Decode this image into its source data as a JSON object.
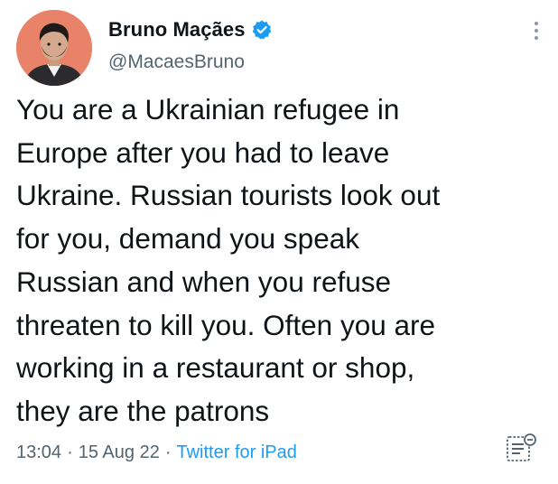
{
  "author": {
    "display_name": "Bruno Maçães",
    "handle": "@MacaesBruno",
    "verified": true
  },
  "tweet": {
    "lines": [
      "You are a Ukrainian refugee in",
      "Europe after you had to leave",
      "Ukraine. Russian tourists look out",
      "for you, demand you speak",
      "Russian and when you refuse",
      "threaten to kill you. Often you are",
      "working in a restaurant or shop,",
      "they are the patrons"
    ]
  },
  "meta": {
    "time": "13:04",
    "separator": "·",
    "date": "15 Aug 22",
    "source": "Twitter for iPad"
  },
  "icons": {
    "verified": "verified-badge-icon",
    "more": "more-options-icon",
    "analytics": "tweet-analytics-icon"
  },
  "colors": {
    "text": "#0f1419",
    "secondary": "#536471",
    "accent": "#1d9bf0",
    "avatar_bg": "#e8836a"
  }
}
